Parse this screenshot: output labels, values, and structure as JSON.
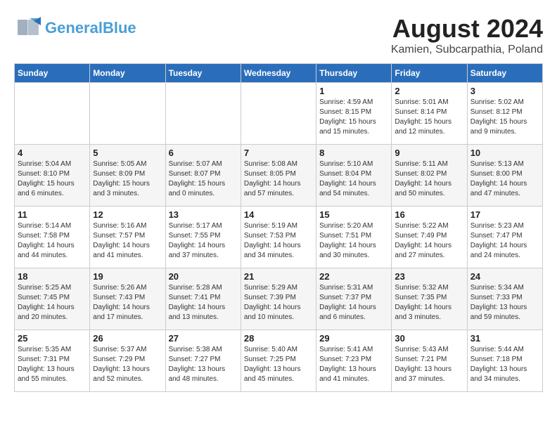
{
  "header": {
    "logo_general": "General",
    "logo_blue": "Blue",
    "title": "August 2024",
    "subtitle": "Kamien, Subcarpathia, Poland"
  },
  "calendar": {
    "days_of_week": [
      "Sunday",
      "Monday",
      "Tuesday",
      "Wednesday",
      "Thursday",
      "Friday",
      "Saturday"
    ],
    "weeks": [
      [
        {
          "day": "",
          "info": ""
        },
        {
          "day": "",
          "info": ""
        },
        {
          "day": "",
          "info": ""
        },
        {
          "day": "",
          "info": ""
        },
        {
          "day": "1",
          "info": "Sunrise: 4:59 AM\nSunset: 8:15 PM\nDaylight: 15 hours and 15 minutes."
        },
        {
          "day": "2",
          "info": "Sunrise: 5:01 AM\nSunset: 8:14 PM\nDaylight: 15 hours and 12 minutes."
        },
        {
          "day": "3",
          "info": "Sunrise: 5:02 AM\nSunset: 8:12 PM\nDaylight: 15 hours and 9 minutes."
        }
      ],
      [
        {
          "day": "4",
          "info": "Sunrise: 5:04 AM\nSunset: 8:10 PM\nDaylight: 15 hours and 6 minutes."
        },
        {
          "day": "5",
          "info": "Sunrise: 5:05 AM\nSunset: 8:09 PM\nDaylight: 15 hours and 3 minutes."
        },
        {
          "day": "6",
          "info": "Sunrise: 5:07 AM\nSunset: 8:07 PM\nDaylight: 15 hours and 0 minutes."
        },
        {
          "day": "7",
          "info": "Sunrise: 5:08 AM\nSunset: 8:05 PM\nDaylight: 14 hours and 57 minutes."
        },
        {
          "day": "8",
          "info": "Sunrise: 5:10 AM\nSunset: 8:04 PM\nDaylight: 14 hours and 54 minutes."
        },
        {
          "day": "9",
          "info": "Sunrise: 5:11 AM\nSunset: 8:02 PM\nDaylight: 14 hours and 50 minutes."
        },
        {
          "day": "10",
          "info": "Sunrise: 5:13 AM\nSunset: 8:00 PM\nDaylight: 14 hours and 47 minutes."
        }
      ],
      [
        {
          "day": "11",
          "info": "Sunrise: 5:14 AM\nSunset: 7:58 PM\nDaylight: 14 hours and 44 minutes."
        },
        {
          "day": "12",
          "info": "Sunrise: 5:16 AM\nSunset: 7:57 PM\nDaylight: 14 hours and 41 minutes."
        },
        {
          "day": "13",
          "info": "Sunrise: 5:17 AM\nSunset: 7:55 PM\nDaylight: 14 hours and 37 minutes."
        },
        {
          "day": "14",
          "info": "Sunrise: 5:19 AM\nSunset: 7:53 PM\nDaylight: 14 hours and 34 minutes."
        },
        {
          "day": "15",
          "info": "Sunrise: 5:20 AM\nSunset: 7:51 PM\nDaylight: 14 hours and 30 minutes."
        },
        {
          "day": "16",
          "info": "Sunrise: 5:22 AM\nSunset: 7:49 PM\nDaylight: 14 hours and 27 minutes."
        },
        {
          "day": "17",
          "info": "Sunrise: 5:23 AM\nSunset: 7:47 PM\nDaylight: 14 hours and 24 minutes."
        }
      ],
      [
        {
          "day": "18",
          "info": "Sunrise: 5:25 AM\nSunset: 7:45 PM\nDaylight: 14 hours and 20 minutes."
        },
        {
          "day": "19",
          "info": "Sunrise: 5:26 AM\nSunset: 7:43 PM\nDaylight: 14 hours and 17 minutes."
        },
        {
          "day": "20",
          "info": "Sunrise: 5:28 AM\nSunset: 7:41 PM\nDaylight: 14 hours and 13 minutes."
        },
        {
          "day": "21",
          "info": "Sunrise: 5:29 AM\nSunset: 7:39 PM\nDaylight: 14 hours and 10 minutes."
        },
        {
          "day": "22",
          "info": "Sunrise: 5:31 AM\nSunset: 7:37 PM\nDaylight: 14 hours and 6 minutes."
        },
        {
          "day": "23",
          "info": "Sunrise: 5:32 AM\nSunset: 7:35 PM\nDaylight: 14 hours and 3 minutes."
        },
        {
          "day": "24",
          "info": "Sunrise: 5:34 AM\nSunset: 7:33 PM\nDaylight: 13 hours and 59 minutes."
        }
      ],
      [
        {
          "day": "25",
          "info": "Sunrise: 5:35 AM\nSunset: 7:31 PM\nDaylight: 13 hours and 55 minutes."
        },
        {
          "day": "26",
          "info": "Sunrise: 5:37 AM\nSunset: 7:29 PM\nDaylight: 13 hours and 52 minutes."
        },
        {
          "day": "27",
          "info": "Sunrise: 5:38 AM\nSunset: 7:27 PM\nDaylight: 13 hours and 48 minutes."
        },
        {
          "day": "28",
          "info": "Sunrise: 5:40 AM\nSunset: 7:25 PM\nDaylight: 13 hours and 45 minutes."
        },
        {
          "day": "29",
          "info": "Sunrise: 5:41 AM\nSunset: 7:23 PM\nDaylight: 13 hours and 41 minutes."
        },
        {
          "day": "30",
          "info": "Sunrise: 5:43 AM\nSunset: 7:21 PM\nDaylight: 13 hours and 37 minutes."
        },
        {
          "day": "31",
          "info": "Sunrise: 5:44 AM\nSunset: 7:18 PM\nDaylight: 13 hours and 34 minutes."
        }
      ]
    ]
  }
}
